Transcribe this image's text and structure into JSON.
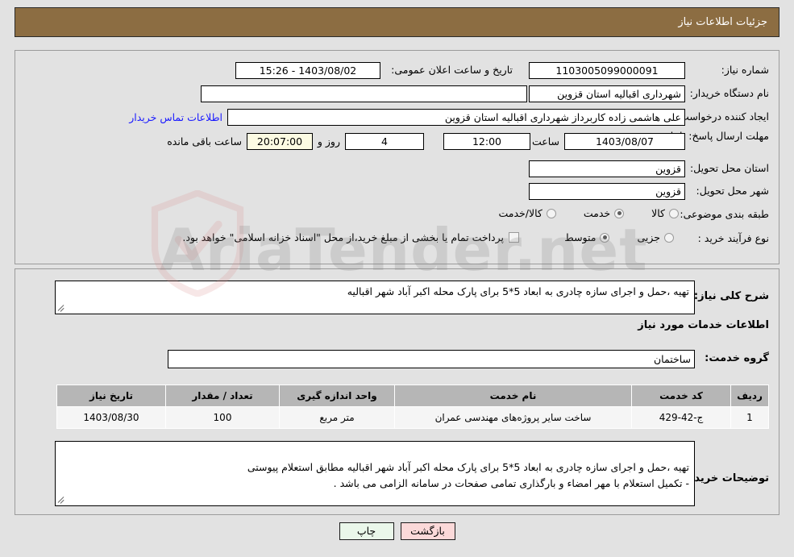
{
  "header": {
    "title": "جزئیات اطلاعات نیاز"
  },
  "need_info": {
    "need_number_label": "شماره نیاز:",
    "need_number_value": "1103005099000091",
    "announce_datetime_label": "تاریخ و ساعت اعلان عمومی:",
    "announce_datetime_value": "1403/08/02 - 15:26",
    "buyer_org_label": "نام دستگاه خریدار:",
    "buyer_org_value": "شهرداری اقبالیه استان قزوین",
    "buyer_org_secondary_value": "",
    "creator_label": "ایجاد کننده درخواست:",
    "creator_value": "علی هاشمی زاده کاربرداز شهرداری اقبالیه استان قزوین",
    "contact_link_label": "اطلاعات تماس خریدار",
    "deadline_label": "مهلت ارسال پاسخ: تا تاریخ:",
    "deadline_date_value": "1403/08/07",
    "deadline_hour_label": "ساعت",
    "deadline_hour_value": "12:00",
    "remaining_days_value": "4",
    "remaining_days_label": "روز و",
    "remaining_time_value": "20:07:00",
    "remaining_time_label": "ساعت باقی مانده",
    "province_label": "استان محل تحویل:",
    "province_value": "قزوین",
    "city_label": "شهر محل تحویل:",
    "city_value": "قزوین",
    "category_label": "طبقه بندی موضوعی:",
    "category_options": [
      {
        "label": "کالا",
        "selected": false
      },
      {
        "label": "خدمت",
        "selected": true
      },
      {
        "label": "کالا/خدمت",
        "selected": false
      }
    ],
    "process_type_label": "نوع فرآیند خرید :",
    "process_type_options": [
      {
        "label": "جزیی",
        "selected": false
      },
      {
        "label": "متوسط",
        "selected": true
      }
    ],
    "treasury_checkbox_checked": false,
    "treasury_note": "پرداخت تمام یا بخشی از مبلغ خرید،از محل \"اسناد خزانه اسلامی\" خواهد بود."
  },
  "need_detail": {
    "general_desc_label": "شرح کلی نیاز:",
    "general_desc_value": "تهیه ،حمل و اجرای سازه چادری به ابعاد 5*5 برای پارک محله اکبر آباد شهر اقبالیه",
    "services_section_heading": "اطلاعات خدمات مورد نیاز",
    "service_group_label": "گروه خدمت:",
    "service_group_value": "ساختمان",
    "table": {
      "columns": [
        "ردیف",
        "کد خدمت",
        "نام خدمت",
        "واحد اندازه گیری",
        "تعداد / مقدار",
        "تاریخ نیاز"
      ],
      "rows": [
        {
          "index": "1",
          "code": "ج-42-429",
          "name": "ساخت سایر پروژه‌های مهندسی عمران",
          "unit": "متر مربع",
          "quantity": "100",
          "need_date": "1403/08/30"
        }
      ]
    },
    "buyer_notes_label": "توضیحات خریدار:",
    "buyer_notes_value": "تهیه ،حمل و اجرای سازه چادری به ابعاد 5*5 برای پارک محله اکبر آباد شهر اقبالیه مطابق استعلام پیوستی\n- تکمیل استعلام با مهر امضاء و بارگذاری تمامی صفحات در سامانه الزامی می باشد ."
  },
  "footer": {
    "back_label": "بازگشت",
    "print_label": "چاپ"
  },
  "watermark": {
    "brand": "AriaTender",
    "domain": ".net"
  },
  "colors": {
    "header_brown": "#8C6D42",
    "panel_bg": "#E2E2E2",
    "link_blue": "#1A1AFF",
    "table_header": "#B6B6B6",
    "countdown_bg": "#FCFBE3",
    "back_button": "#FBD9D9",
    "print_button": "#EAF7EA"
  }
}
